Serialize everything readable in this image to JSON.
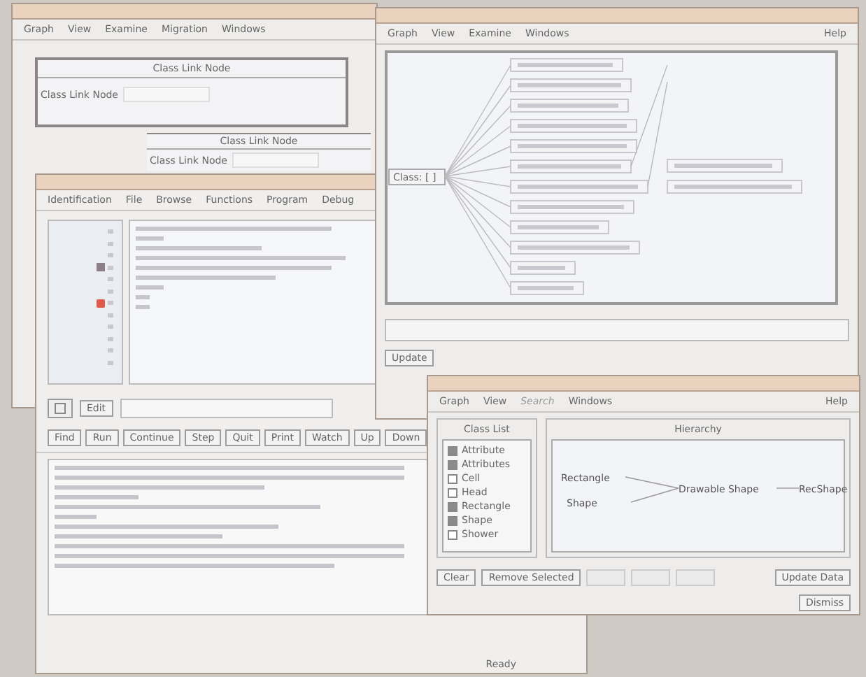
{
  "windows": [
    {
      "kind": "link_browser",
      "menu": [
        "Graph",
        "View",
        "Examine",
        "Migration",
        "Windows"
      ],
      "panels": [
        {
          "title": "Class Link Node",
          "label": "Class Link Node"
        },
        {
          "title": "Class Link Node",
          "label": "Class Link Node"
        }
      ]
    },
    {
      "kind": "editor",
      "menu": [
        "Identification",
        "File",
        "Browse",
        "Functions",
        "Program",
        "Debug"
      ],
      "gutter": [
        {
          "kind": "plain"
        },
        {
          "kind": "plain"
        },
        {
          "kind": "plain"
        },
        {
          "kind": "stop"
        },
        {
          "kind": "plain"
        },
        {
          "kind": "plain"
        },
        {
          "kind": "breakpoint"
        },
        {
          "kind": "plain"
        },
        {
          "kind": "plain"
        },
        {
          "kind": "plain"
        },
        {
          "kind": "plain"
        },
        {
          "kind": "plain"
        }
      ],
      "edit_button": "Edit",
      "buttons": [
        "Find",
        "Run",
        "Continue",
        "Step",
        "Quit",
        "Print",
        "Watch",
        "Up",
        "Down"
      ],
      "status": "Ready"
    },
    {
      "kind": "call_graph",
      "menu": [
        "Graph",
        "View",
        "Examine",
        "Windows"
      ],
      "help": "Help",
      "root": "Class: [ ]",
      "update_button": "Update"
    },
    {
      "kind": "hierarchy",
      "menu": [
        {
          "label": "Graph",
          "disabled": false
        },
        {
          "label": "View",
          "disabled": false
        },
        {
          "label": "Search",
          "disabled": true
        },
        {
          "label": "Windows",
          "disabled": false
        }
      ],
      "help": "Help",
      "class_list": {
        "title": "Class List",
        "items": [
          {
            "label": "Attribute",
            "checked": true
          },
          {
            "label": "Attributes",
            "checked": true
          },
          {
            "label": "Cell",
            "checked": false
          },
          {
            "label": "Head",
            "checked": false
          },
          {
            "label": "Rectangle",
            "checked": true
          },
          {
            "label": "Shape",
            "checked": true
          },
          {
            "label": "Shower",
            "checked": false
          }
        ]
      },
      "hierarchy_title": "Hierarchy",
      "nodes": [
        "Rectangle",
        "Shape",
        "Drawable Shape",
        "RecShape"
      ],
      "buttons": [
        {
          "label": "Clear",
          "disabled": false
        },
        {
          "label": "Remove Selected",
          "disabled": false
        },
        {
          "disabled": true
        },
        {
          "disabled": true
        },
        {
          "disabled": true
        },
        {
          "label": "Update Data",
          "disabled": false
        }
      ],
      "dismiss": "Dismiss"
    }
  ]
}
